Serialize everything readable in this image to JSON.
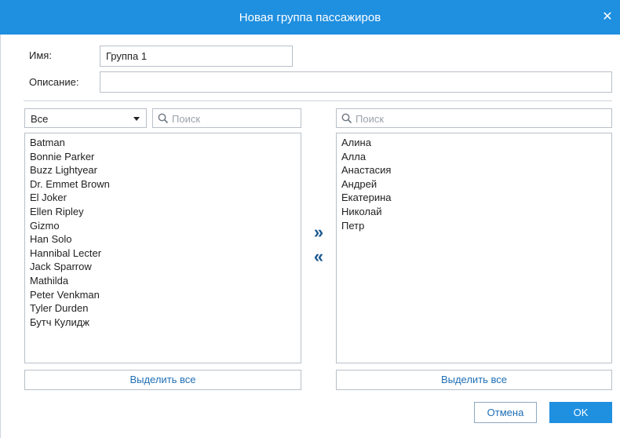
{
  "dialog": {
    "title": "Новая группа пассажиров",
    "close_icon": "close-icon",
    "accent_color": "#1f8fe0"
  },
  "form": {
    "name_label": "Имя:",
    "name_value": "Группа 1",
    "description_label": "Описание:",
    "description_value": ""
  },
  "left_panel": {
    "filter_selected": "Все",
    "search_placeholder": "Поиск",
    "items": [
      "Batman",
      "Bonnie Parker",
      "Buzz Lightyear",
      "Dr. Emmet Brown",
      "El Joker",
      "Ellen Ripley",
      "Gizmo",
      "Han Solo",
      "Hannibal Lecter",
      "Jack Sparrow",
      "Mathilda",
      "Peter Venkman",
      "Tyler Durden",
      "Бутч Кулидж"
    ],
    "select_all_label": "Выделить все"
  },
  "transfer": {
    "add_label": "»",
    "remove_label": "«"
  },
  "right_panel": {
    "search_placeholder": "Поиск",
    "items": [
      "Алина",
      "Алла",
      "Анастасия",
      "Андрей",
      "Екатерина",
      "Николай",
      "Петр"
    ],
    "select_all_label": "Выделить все"
  },
  "footer": {
    "cancel_label": "Отмена",
    "ok_label": "OK"
  }
}
